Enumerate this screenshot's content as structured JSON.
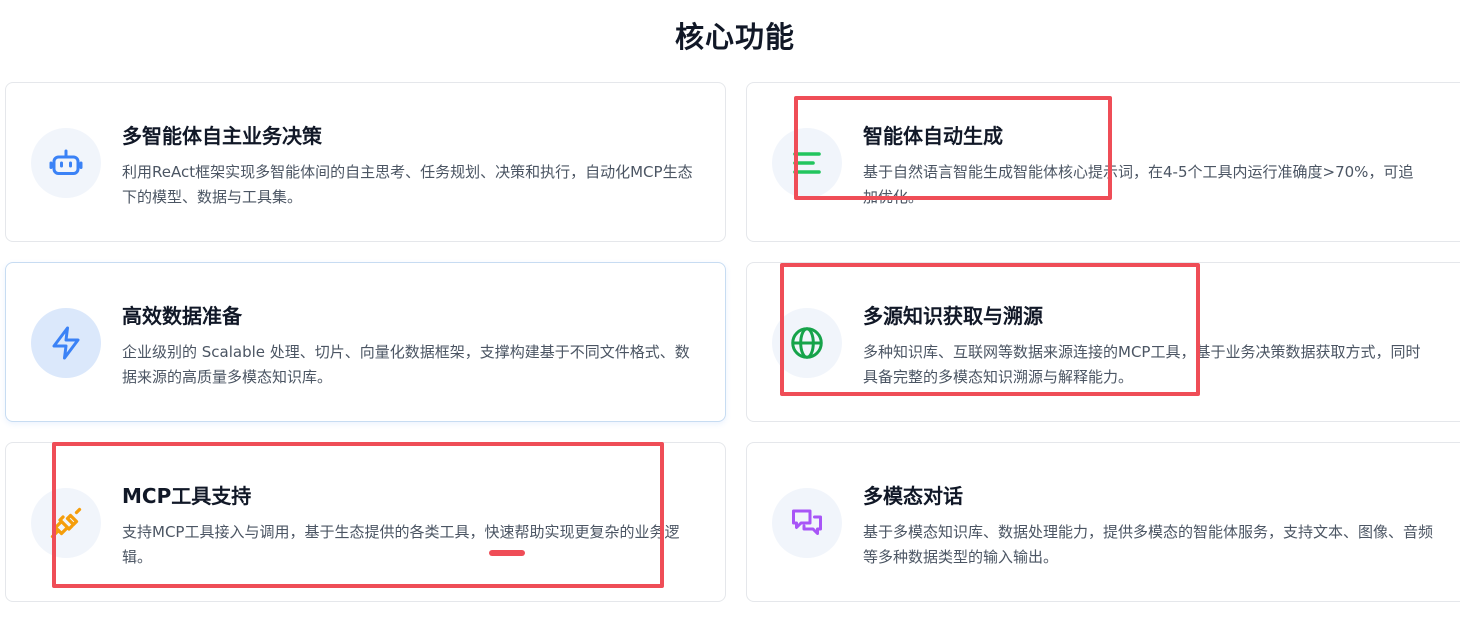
{
  "section": {
    "title": "核心功能"
  },
  "features": [
    {
      "title": "多智能体自主业务决策",
      "description": "利用ReAct框架实现多智能体间的自主思考、任务规划、决策和执行，自动化MCP生态下的模型、数据与工具集。",
      "icon": "robot-icon",
      "icon_color": "#3b82f6"
    },
    {
      "title": "智能体自动生成",
      "description": "基于自然语言智能生成智能体核心提示词，在4-5个工具内运行准确度>70%，可追加优化。",
      "icon": "list-icon",
      "icon_color": "#22c55e"
    },
    {
      "title": "高效数据准备",
      "description": "企业级别的 Scalable 处理、切片、向量化数据框架，支撑构建基于不同文件格式、数据来源的高质量多模态知识库。",
      "icon": "lightning-icon",
      "icon_color": "#3b82f6"
    },
    {
      "title": "多源知识获取与溯源",
      "description": "多种知识库、互联网等数据来源连接的MCP工具，基于业务决策数据获取方式，同时具备完整的多模态知识溯源与解释能力。",
      "icon": "globe-icon",
      "icon_color": "#16a34a"
    },
    {
      "title": "MCP工具支持",
      "description": "支持MCP工具接入与调用，基于生态提供的各类工具，快速帮助实现更复杂的业务逻辑。",
      "icon": "plug-icon",
      "icon_color": "#f59e0b"
    },
    {
      "title": "多模态对话",
      "description": "基于多模态知识库、数据处理能力，提供多模态的智能体服务，支持文本、图像、音频等多种数据类型的输入输出。",
      "icon": "chat-bubbles-icon",
      "icon_color": "#a855f7"
    }
  ],
  "colors": {
    "annotation": "#ef4d57",
    "card_border": "#e5e7eb",
    "active_card_border": "#c7dcf2"
  }
}
